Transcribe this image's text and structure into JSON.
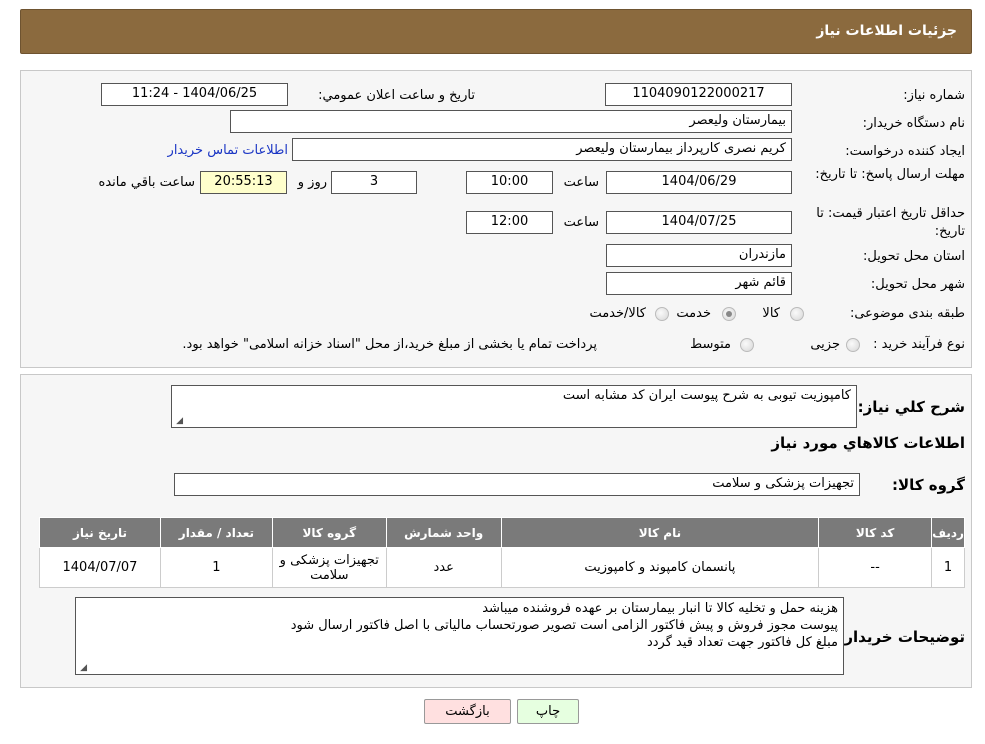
{
  "header": {
    "title": "جزئیات اطلاعات نیاز"
  },
  "info": {
    "need_number_label": "شماره نیاز:",
    "need_number": "1104090122000217",
    "announce_label": "تاریخ و ساعت اعلان عمومي:",
    "announce_value": "1404/06/25 - 11:24",
    "buyer_org_label": "نام دستگاه خریدار:",
    "buyer_org": "بیمارستان ولیعصر",
    "creator_label": "ایجاد کننده درخواست:",
    "creator": "کریم نصری کارپرداز بیمارستان ولیعصر",
    "contact_link": "اطلاعات تماس خریدار",
    "deadline_label": "مهلت ارسال پاسخ: تا تاریخ:",
    "deadline_date": "1404/06/29",
    "time_label": "ساعت",
    "deadline_time": "10:00",
    "days_value": "3",
    "days_label": "روز و",
    "remaining_time": "20:55:13",
    "remaining_label": "ساعت باقي مانده",
    "validity_label": "حداقل تاریخ اعتبار قیمت: تا تاریخ:",
    "validity_date": "1404/07/25",
    "validity_time": "12:00",
    "province_label": "استان محل تحویل:",
    "province": "مازندران",
    "city_label": "شهر محل تحویل:",
    "city": "قائم شهر",
    "category_label": "طبقه بندی موضوعی:",
    "category_options": [
      "کالا",
      "خدمت",
      "کالا/خدمت"
    ],
    "process_label": "نوع فرآیند خرید :",
    "process_options": [
      "جزیی",
      "متوسط"
    ],
    "process_note": "پرداخت تمام یا بخشی از مبلغ خرید،از محل \"اسناد خزانه اسلامی\" خواهد بود."
  },
  "details": {
    "summary_label": "شرح کلي نیاز:",
    "summary": "کامپوزیت تیوبی به شرح پیوست   ایران کد مشابه است",
    "goods_info_title": "اطلاعات کالاهاي مورد نیاز",
    "goods_group_label": "گروه کالا:",
    "goods_group": "تجهیزات پزشکی و سلامت"
  },
  "table": {
    "headers": [
      "ردیف",
      "کد کالا",
      "نام کالا",
      "واحد شمارش",
      "گروه کالا",
      "تعداد / مقدار",
      "تاریخ نیاز"
    ],
    "rows": [
      [
        "1",
        "--",
        "پانسمان کامپوند و کامپوزیت",
        "عدد",
        "تجهیزات پزشکی و سلامت",
        "1",
        "1404/07/07"
      ]
    ]
  },
  "buyer_notes": {
    "label": "توضیحات خریدار:",
    "lines": [
      "هزینه حمل و تخلیه کالا تا انبار بیمارستان بر عهده فروشنده میباشد",
      "پیوست مجوز فروش و پیش فاکتور الزامی است  تصویر صورتحساب مالیاتی با اصل فاکتور ارسال شود",
      "مبلغ کل فاکتور جهت تعداد قید گردد"
    ]
  },
  "buttons": {
    "print": "چاپ",
    "back": "بازگشت"
  },
  "colors": {
    "header": "#8b6a3e",
    "back_button": "#ffe0e0",
    "print_button": "#e6ffe0",
    "time_box": "#ffffcc"
  }
}
